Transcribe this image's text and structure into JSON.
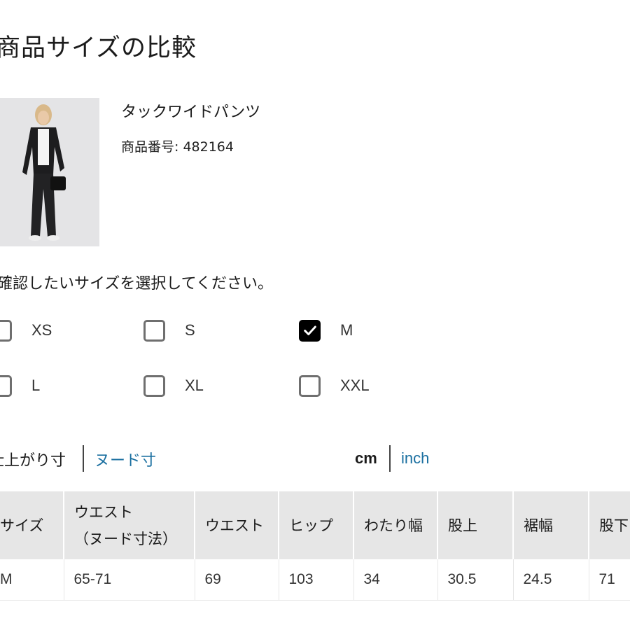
{
  "title": "商品サイズの比較",
  "product": {
    "name": "タックワイドパンツ",
    "number_label": "商品番号: 482164",
    "image_alt": "product-photo"
  },
  "prompt": "確認したいサイズを選択してください。",
  "sizes": [
    {
      "label": "XS",
      "checked": false
    },
    {
      "label": "S",
      "checked": false
    },
    {
      "label": "M",
      "checked": true
    },
    {
      "label": "L",
      "checked": false
    },
    {
      "label": "XL",
      "checked": false
    },
    {
      "label": "XXL",
      "checked": false
    }
  ],
  "measure_toggle": {
    "finished": "仕上がり寸",
    "nude": "ヌード寸"
  },
  "unit_toggle": {
    "cm": "cm",
    "inch": "inch"
  },
  "table": {
    "headers": [
      "サイズ",
      "ウエスト\n（ヌード寸法）",
      "ウエスト",
      "ヒップ",
      "わたり幅",
      "股上",
      "裾幅",
      "股下"
    ],
    "rows": [
      [
        "M",
        "65-71",
        "69",
        "103",
        "34",
        "30.5",
        "24.5",
        "71"
      ]
    ]
  },
  "colors": {
    "accent_link": "#1a6fa0",
    "header_bg": "#e6e6e6",
    "checked": "#000000"
  }
}
